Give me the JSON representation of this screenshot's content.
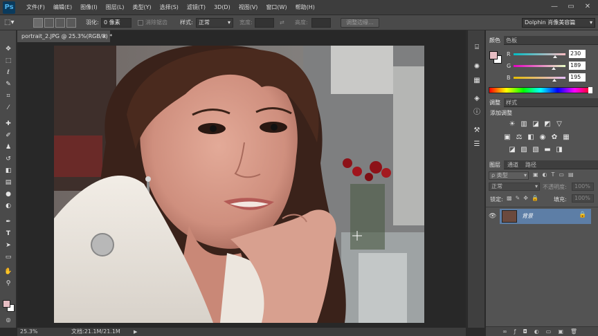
{
  "app": {
    "logo": "Ps"
  },
  "menu": [
    "文件(F)",
    "编辑(E)",
    "图像(I)",
    "图层(L)",
    "类型(Y)",
    "选择(S)",
    "滤镜(T)",
    "3D(D)",
    "视图(V)",
    "窗口(W)",
    "帮助(H)"
  ],
  "window_controls": {
    "minimize": "—",
    "restore": "▭",
    "close": "✕"
  },
  "options": {
    "feather_label": "羽化:",
    "feather_value": "0 像素",
    "antialias_label": "消除锯齿",
    "style_label": "样式:",
    "style_value": "正常",
    "width_label": "宽度:",
    "height_label": "高度:",
    "refine_edge": "调整边缘...",
    "workspace": "Dolphin 肖像美容篇"
  },
  "document": {
    "tab_title": "portrait_2.JPG @ 25.3%(RGB/8) *",
    "tab_close": "×"
  },
  "status": {
    "zoom": "25.3%",
    "doc_size": "文档:21.1M/21.1M"
  },
  "color_panel": {
    "tabs": [
      "颜色",
      "色板"
    ],
    "channels": [
      {
        "label": "R",
        "value": "230"
      },
      {
        "label": "G",
        "value": "189"
      },
      {
        "label": "B",
        "value": "195"
      }
    ],
    "foreground_color": "#e6bdc3"
  },
  "adjustments_panel": {
    "tabs": [
      "调整",
      "样式"
    ],
    "title": "添加调整"
  },
  "layers_panel": {
    "tabs": [
      "图层",
      "通道",
      "路径"
    ],
    "filter_placeholder": "ρ 类型",
    "blend_mode": "正常",
    "opacity_label": "不透明度:",
    "opacity_value": "100%",
    "lock_label": "锁定:",
    "fill_label": "填充:",
    "fill_value": "100%",
    "layers": [
      {
        "name": "背景",
        "selected": true,
        "locked": true
      }
    ]
  },
  "colors": {
    "selected_layer": "#5d7ea6",
    "panel_bg": "#535353"
  }
}
